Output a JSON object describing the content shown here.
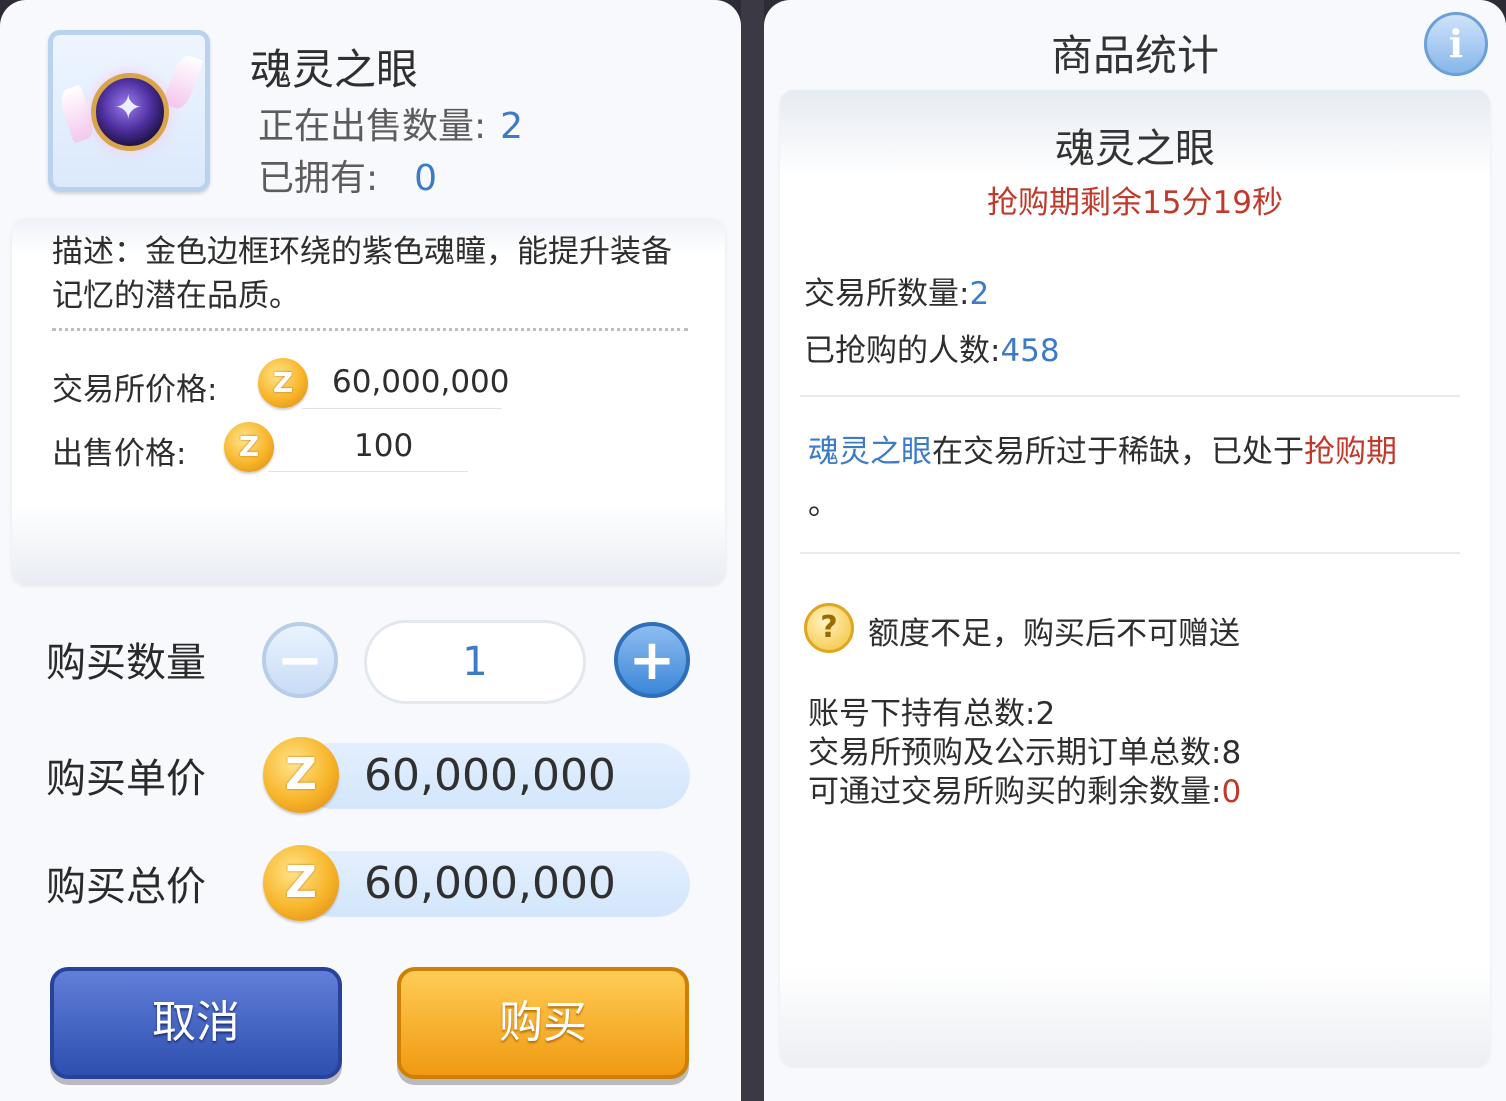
{
  "item": {
    "name": "魂灵之眼",
    "on_sale_label": "正在出售数量:",
    "on_sale_value": "2",
    "owned_label": "已拥有:",
    "owned_value": "0",
    "description": "描述：金色边框环绕的紫色魂瞳，能提升装备记忆的潜在品质。",
    "exchange_price_label": "交易所价格:",
    "exchange_price": "60,000,000",
    "sell_price_label": "出售价格:",
    "sell_price": "100",
    "icon": "purple-soul-eye-gem-icon"
  },
  "purchase": {
    "quantity_label": "购买数量",
    "quantity": "1",
    "minus": "−",
    "plus": "+",
    "unit_price_label": "购买单价",
    "unit_price": "60,000,000",
    "total_price_label": "购买总价",
    "total_price": "60,000,000",
    "cancel": "取消",
    "buy": "购买"
  },
  "stats": {
    "title": "商品统计",
    "info_icon": "i",
    "item_name": "魂灵之眼",
    "timer": "抢购期剩余15分19秒",
    "exchange_qty_label": "交易所数量:",
    "exchange_qty": "2",
    "grabbed_label": "已抢购的人数:",
    "grabbed": "458",
    "notice_item": "魂灵之眼",
    "notice_mid": "在交易所过于稀缺，已处于",
    "notice_period": "抢购期",
    "notice_end": "。",
    "quota_icon": "?",
    "quota_text": "额度不足，购买后不可赠送",
    "account_total_label": "账号下持有总数:",
    "account_total": "2",
    "orders_label": "交易所预购及公示期订单总数:",
    "orders": "8",
    "remaining_label": "可通过交易所购买的剩余数量:",
    "remaining": "0"
  },
  "colors": {
    "accent_blue": "#3d7bc7",
    "alert_red": "#c0392b",
    "cancel_button": "#2f4fb0",
    "buy_button": "#f09a12",
    "coin_gold": "#f7b52a"
  }
}
